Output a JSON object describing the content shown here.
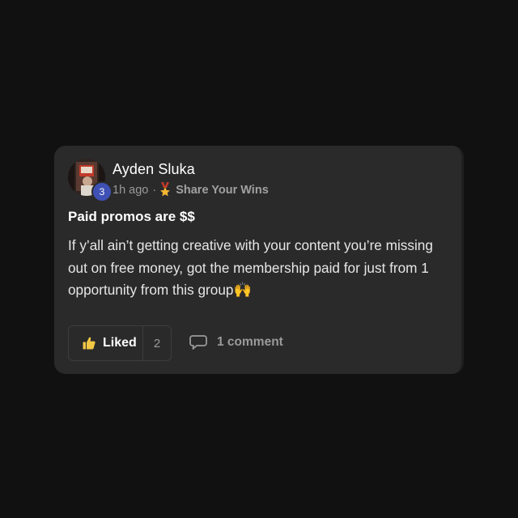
{
  "post": {
    "author": "Ayden Sluka",
    "level": "3",
    "time_ago": "1h ago",
    "separator": "·",
    "category": "Share Your Wins",
    "category_icon": "medal-icon",
    "title": "Paid promos are $$",
    "body": "If y’all ain’t getting creative with your content you’re missing out on free money, got the membership paid for just from 1 opportunity from this group",
    "body_emoji": "🙌"
  },
  "actions": {
    "like_label": "Liked",
    "like_icon": "thumbs-up-icon",
    "like_count": "2",
    "comment_label": "1 comment",
    "comment_icon": "comment-bubble-icon"
  },
  "colors": {
    "background": "#111111",
    "card": "#2a2a2b",
    "level_badge": "#3f51b5",
    "like_icon": "#f2c744"
  }
}
